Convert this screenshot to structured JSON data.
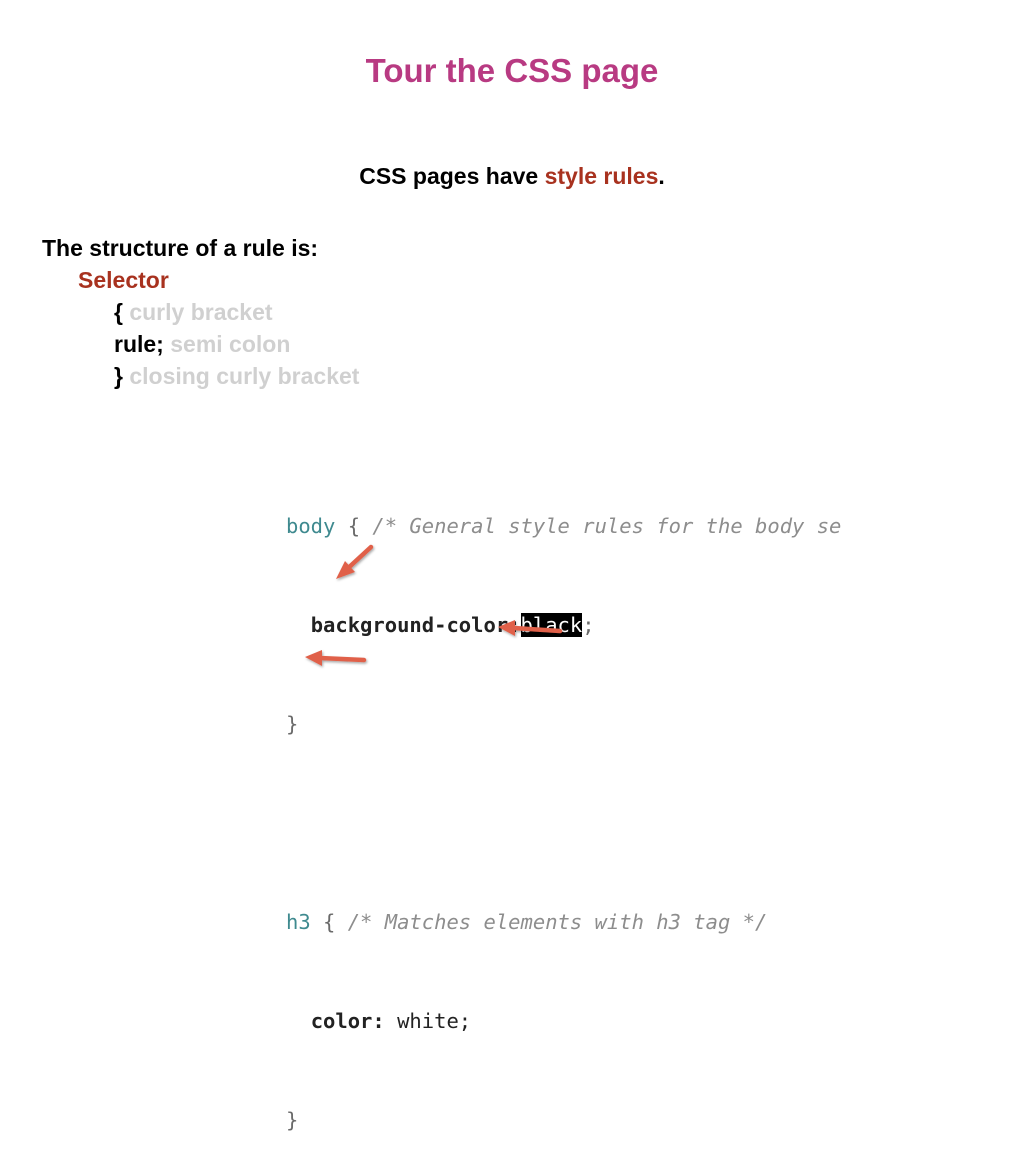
{
  "title": "Tour the CSS page",
  "subtitle": {
    "prefix": "CSS pages have ",
    "highlight": "style rules",
    "suffix": "."
  },
  "structure": {
    "heading": "The structure of a rule is:",
    "selector": "Selector",
    "open_symbol": "{",
    "open_hint": " curly bracket",
    "rule_symbol": "rule;",
    "rule_hint": " semi colon",
    "close_symbol": "}",
    "close_hint": " closing curly bracket"
  },
  "code": {
    "line1_selector": "body",
    "line1_brace": " { ",
    "line1_comment": "/* General style rules for the body se",
    "line2_indent": "  ",
    "line2_property": "background-color:",
    "line2_value": "black",
    "line2_end": ";",
    "line3_brace": "}",
    "line5_selector": "h3",
    "line5_brace": " { ",
    "line5_comment": "/* Matches elements with h3 tag */",
    "line6_indent": "  ",
    "line6_property": "color:",
    "line6_value": " white;",
    "line7_brace": "}"
  },
  "colors": {
    "title": "#b83a82",
    "accent": "#a8321f",
    "hint": "#d0d0d0",
    "arrow": "#e0604a",
    "code_selector": "#3f8a8f"
  },
  "icons": [
    "arrow-to-open-brace",
    "arrow-to-rule",
    "arrow-to-close-brace"
  ]
}
